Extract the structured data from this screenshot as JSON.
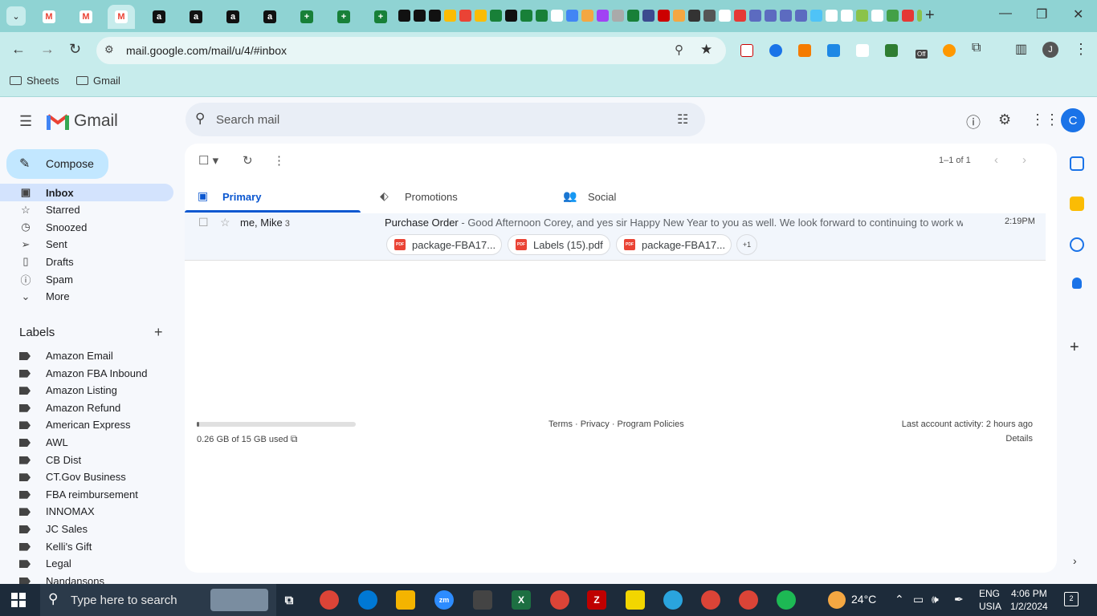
{
  "browser": {
    "url": "mail.google.com/mail/u/4/#inbox",
    "bookmarks": [
      "Sheets",
      "Gmail"
    ],
    "extension_badge": "Off"
  },
  "gmail": {
    "app_name": "Gmail",
    "search_placeholder": "Search mail",
    "avatar_letter": "C",
    "profile_letter": "J",
    "compose_label": "Compose",
    "nav": [
      {
        "label": "Inbox",
        "icon": "inbox-icon",
        "active": true
      },
      {
        "label": "Starred",
        "icon": "star-icon"
      },
      {
        "label": "Snoozed",
        "icon": "clock-icon"
      },
      {
        "label": "Sent",
        "icon": "send-icon"
      },
      {
        "label": "Drafts",
        "icon": "draft-icon"
      },
      {
        "label": "Spam",
        "icon": "spam-icon"
      },
      {
        "label": "More",
        "icon": "chevron-down-icon"
      }
    ],
    "labels_heading": "Labels",
    "labels": [
      "Amazon Email",
      "Amazon FBA Inbound",
      "Amazon Listing",
      "Amazon Refund",
      "American Express",
      "AWL",
      "CB Dist",
      "CT.Gov Business",
      "FBA reimbursement",
      "INNOMAX",
      "JC Sales",
      "Kelli's Gift",
      "Legal",
      "Nandansons"
    ],
    "page_count": "1–1 of 1",
    "tabs": [
      {
        "label": "Primary",
        "icon": "inbox-icon",
        "active": true
      },
      {
        "label": "Promotions",
        "icon": "tag-icon"
      },
      {
        "label": "Social",
        "icon": "people-icon"
      }
    ],
    "email": {
      "sender": "me, Mike",
      "thread_count": "3",
      "subject": "Purchase Order",
      "snippet": " - Good Afternoon Corey, and yes sir Happy New Year to you as well. We look forward to continuing to work wi...",
      "time": "2:19PM",
      "attachments": [
        "package-FBA17...",
        "Labels (15).pdf",
        "package-FBA17..."
      ],
      "more_attachments": "+1"
    },
    "storage": {
      "text": "0.26 GB of 15 GB used",
      "fraction": 0.017
    },
    "footer_links": "Terms · Privacy · Program Policies",
    "last_activity": "Last account activity: 2 hours ago",
    "details": "Details"
  },
  "taskbar": {
    "search_placeholder": "Type here to search",
    "weather": "24°C",
    "lang1": "ENG",
    "lang2": "USIA",
    "time": "4:06 PM",
    "date": "1/2/2024",
    "notifications": "2"
  },
  "colors": {
    "accent": "#0b57d0",
    "chrome": "#8fd3d3",
    "compose": "#c2e7ff"
  }
}
